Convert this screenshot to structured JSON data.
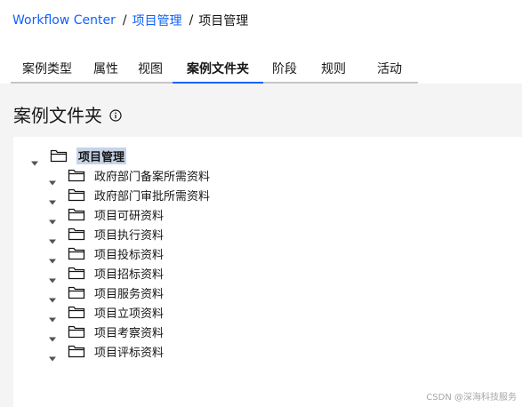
{
  "breadcrumb": {
    "root": "Workflow Center",
    "parent": "项目管理",
    "current": "项目管理",
    "separator": "/"
  },
  "tabs": [
    {
      "label": "案例类型",
      "active": false
    },
    {
      "label": "属性",
      "active": false
    },
    {
      "label": "视图",
      "active": false
    },
    {
      "label": "案例文件夹",
      "active": true
    },
    {
      "label": "阶段",
      "active": false
    },
    {
      "label": "规则",
      "active": false
    },
    {
      "label": "活动",
      "active": false
    }
  ],
  "page": {
    "title": "案例文件夹",
    "info_icon": "info-circle-icon"
  },
  "tree": {
    "root": {
      "label": "项目管理",
      "expanded": true,
      "selected": true
    },
    "children": [
      {
        "label": "政府部门备案所需资料"
      },
      {
        "label": "政府部门审批所需资料"
      },
      {
        "label": "项目可研资料"
      },
      {
        "label": "项目执行资料"
      },
      {
        "label": "项目投标资料"
      },
      {
        "label": "项目招标资料"
      },
      {
        "label": "项目服务资料"
      },
      {
        "label": "项目立项资料"
      },
      {
        "label": "项目考察资料"
      },
      {
        "label": "项目评标资料"
      }
    ]
  },
  "watermark": "CSDN @深海科技服务",
  "colors": {
    "link": "#0f62fe",
    "tab_active_underline": "#0f62fe",
    "content_background": "#f4f4f4",
    "selected_highlight": "#c6d4e8"
  }
}
